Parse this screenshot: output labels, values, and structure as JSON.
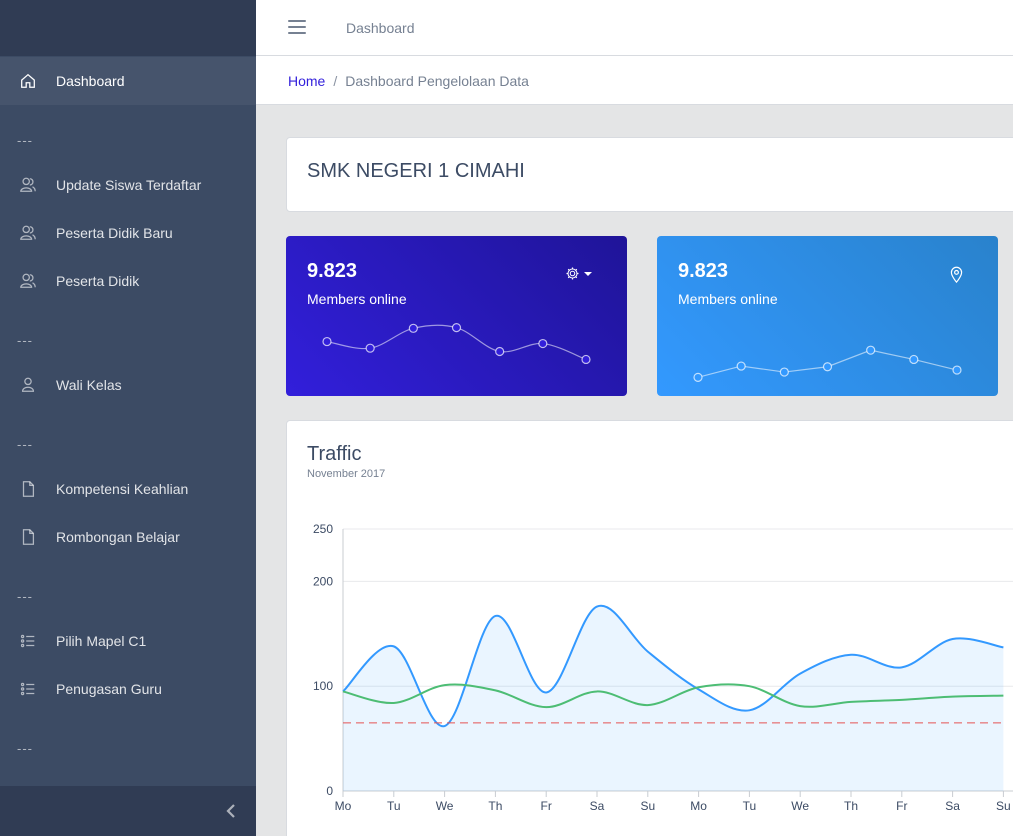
{
  "header": {
    "nav_link": "Dashboard"
  },
  "breadcrumb": {
    "home": "Home",
    "separator": "/",
    "current": "Dashboard Pengelolaan Data"
  },
  "sidebar": {
    "items": [
      {
        "label": "Dashboard",
        "icon": "home-icon"
      },
      {
        "label": "Update Siswa Terdaftar",
        "icon": "people-icon"
      },
      {
        "label": "Peserta Didik Baru",
        "icon": "people-icon"
      },
      {
        "label": "Peserta Didik",
        "icon": "people-icon"
      },
      {
        "label": "Wali Kelas",
        "icon": "user-icon"
      },
      {
        "label": "Kompetensi Keahlian",
        "icon": "file-icon"
      },
      {
        "label": "Rombongan Belajar",
        "icon": "file-icon"
      },
      {
        "label": "Pilih Mapel C1",
        "icon": "list-icon"
      },
      {
        "label": "Penugasan Guru",
        "icon": "list-icon"
      }
    ],
    "separator": "---"
  },
  "school": {
    "title": "SMK NEGERI 1 CIMAHI"
  },
  "stats": [
    {
      "value": "9.823",
      "label": "Members online",
      "icon": "gear-icon",
      "color": "#321fdb",
      "spark": [
        55,
        45,
        75,
        76,
        40,
        52,
        28
      ]
    },
    {
      "value": "9.823",
      "label": "Members online",
      "icon": "location-pin-icon",
      "color": "#3399ff",
      "spark": [
        1,
        18,
        9,
        17,
        42,
        28,
        12
      ]
    }
  ],
  "traffic": {
    "title": "Traffic",
    "subtitle": "November 2017"
  },
  "chart_data": {
    "type": "line",
    "title": "Traffic",
    "subtitle": "November 2017",
    "categories": [
      "Mo",
      "Tu",
      "We",
      "Th",
      "Fr",
      "Sa",
      "Su",
      "Mo",
      "Tu",
      "We",
      "Th",
      "Fr",
      "Sa",
      "Su"
    ],
    "y_ticks": [
      0,
      100,
      200,
      250
    ],
    "ylim": [
      0,
      250
    ],
    "grid": true,
    "series": [
      {
        "values": [
          95,
          138,
          62,
          167,
          94,
          176,
          133,
          97,
          77,
          112,
          130,
          118,
          145,
          137
        ],
        "color": "#39f",
        "fill": true
      },
      {
        "values": [
          95,
          84,
          101,
          96,
          80,
          95,
          82,
          99,
          100,
          81,
          85,
          87,
          90,
          91
        ],
        "color": "#4dbd74"
      },
      {
        "values": [
          65,
          65,
          65,
          65,
          65,
          65,
          65,
          65,
          65,
          65,
          65,
          65,
          65,
          65
        ],
        "color": "#e55353",
        "dashed": true
      }
    ]
  }
}
